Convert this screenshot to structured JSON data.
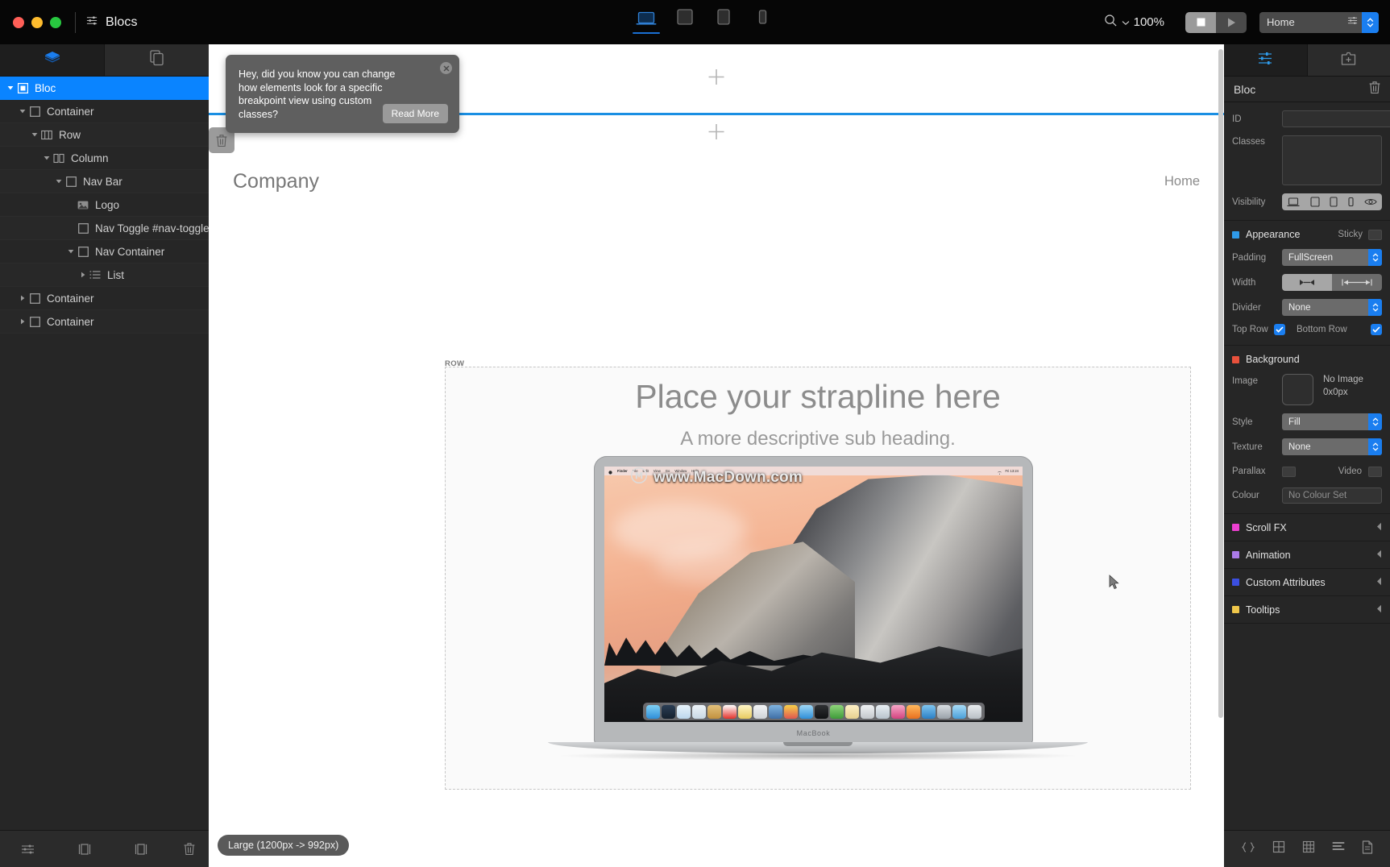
{
  "window": {
    "app_title": "Blocs",
    "traffic_lights": [
      "close-red",
      "minimize-yellow",
      "zoom-green"
    ],
    "breakpoints": [
      {
        "name": "desktop",
        "icon": "laptop-icon",
        "active": true
      },
      {
        "name": "tablet-landscape",
        "icon": "tablet-landscape-icon",
        "active": false
      },
      {
        "name": "tablet-portrait",
        "icon": "tablet-portrait-icon",
        "active": false
      },
      {
        "name": "mobile",
        "icon": "phone-icon",
        "active": false
      }
    ],
    "zoom_level": "100%",
    "page_selector_value": "Home"
  },
  "sidebar": {
    "tabs": [
      {
        "name": "layers-tab",
        "icon": "layers-icon",
        "active": true
      },
      {
        "name": "pages-tab",
        "icon": "copy-pages-icon",
        "active": false
      }
    ],
    "tree": [
      {
        "label": "Bloc",
        "depth": 0,
        "icon": "bloc-icon",
        "disclosure": "open",
        "selected": true
      },
      {
        "label": "Container",
        "depth": 1,
        "icon": "square-icon",
        "disclosure": "open",
        "selected": false
      },
      {
        "label": "Row",
        "depth": 2,
        "icon": "row-icon",
        "disclosure": "open",
        "selected": false
      },
      {
        "label": "Column",
        "depth": 3,
        "icon": "column-icon",
        "disclosure": "open",
        "selected": false
      },
      {
        "label": "Nav Bar",
        "depth": 4,
        "icon": "square-icon",
        "disclosure": "open",
        "selected": false
      },
      {
        "label": "Logo",
        "depth": 5,
        "icon": "image-icon",
        "disclosure": "none",
        "selected": false
      },
      {
        "label": "Nav Toggle #nav-toggle",
        "depth": 5,
        "icon": "square-icon",
        "disclosure": "none",
        "selected": false
      },
      {
        "label": "Nav Container",
        "depth": 5,
        "icon": "square-icon",
        "disclosure": "open",
        "selected": false
      },
      {
        "label": "List",
        "depth": 6,
        "icon": "list-icon",
        "disclosure": "closed",
        "selected": false
      },
      {
        "label": "Container",
        "depth": 1,
        "icon": "square-icon",
        "disclosure": "closed",
        "selected": false
      },
      {
        "label": "Container",
        "depth": 1,
        "icon": "square-icon",
        "disclosure": "closed",
        "selected": false
      }
    ],
    "bottom_tools": [
      {
        "name": "settings-sliders-icon"
      },
      {
        "name": "add-bloc-left-icon"
      },
      {
        "name": "add-bloc-right-icon"
      },
      {
        "name": "delete-icon"
      }
    ]
  },
  "tooltip": {
    "message": "Hey, did you know you can change how elements look for a specific breakpoint view using custom classes?",
    "action_label": "Read More",
    "close_label": "✕"
  },
  "canvas": {
    "brand": "Company",
    "nav_links": [
      "Home"
    ],
    "row_label": "ROW",
    "strapline": "Place your strapline here",
    "subheading": "A more descriptive sub heading.",
    "watermark": "www.MacDown.com",
    "macbook_label": "MacBook",
    "mac_menu_items": [
      "Finder",
      "File",
      "Edit",
      "View",
      "Go",
      "Window",
      "Help"
    ],
    "mac_menu_clock": "Fri 13:24",
    "breakpoint_badge": "Large (1200px -> 992px)",
    "add_bloc_tooltip": "+"
  },
  "inspector": {
    "tabs": [
      {
        "name": "settings-tab",
        "icon": "sliders-icon",
        "active": true
      },
      {
        "name": "assets-tab",
        "icon": "add-asset-icon",
        "active": false
      }
    ],
    "title": "Bloc",
    "delete_icon": "trash-icon",
    "fields": {
      "id_label": "ID",
      "id_value": "",
      "classes_label": "Classes",
      "classes_value": "",
      "visibility_label": "Visibility",
      "visibility_icons": [
        "laptop-icon",
        "tablet-landscape-icon",
        "tablet-portrait-icon",
        "phone-icon",
        "eye-icon"
      ]
    },
    "appearance": {
      "title": "Appearance",
      "colour": "#2f9ae8",
      "sticky_label": "Sticky",
      "sticky_on": false,
      "padding_label": "Padding",
      "padding_value": "FullScreen",
      "width_label": "Width",
      "width_mode": "contained",
      "divider_label": "Divider",
      "divider_value": "None",
      "top_row_label": "Top Row",
      "top_row_checked": true,
      "bottom_row_label": "Bottom Row",
      "bottom_row_checked": true
    },
    "background": {
      "title": "Background",
      "colour": "#e8513c",
      "image_label": "Image",
      "image_status": "No Image",
      "image_size": "0x0px",
      "style_label": "Style",
      "style_value": "Fill",
      "texture_label": "Texture",
      "texture_value": "None",
      "parallax_label": "Parallax",
      "parallax_on": false,
      "video_label": "Video",
      "video_on": false,
      "colour_label": "Colour",
      "colour_value": "No Colour Set"
    },
    "accordions": [
      {
        "title": "Scroll FX",
        "colour": "#ec3fd0",
        "expanded": false
      },
      {
        "title": "Animation",
        "colour": "#ab7be8",
        "expanded": false
      },
      {
        "title": "Custom Attributes",
        "colour": "#3b4fe0",
        "expanded": false
      },
      {
        "title": "Tooltips",
        "colour": "#efc64a",
        "expanded": false
      }
    ],
    "bottom_tools": [
      {
        "name": "code-brackets-icon"
      },
      {
        "name": "grid-small-icon"
      },
      {
        "name": "grid-large-icon"
      },
      {
        "name": "list-lines-icon"
      },
      {
        "name": "page-icon"
      }
    ]
  }
}
